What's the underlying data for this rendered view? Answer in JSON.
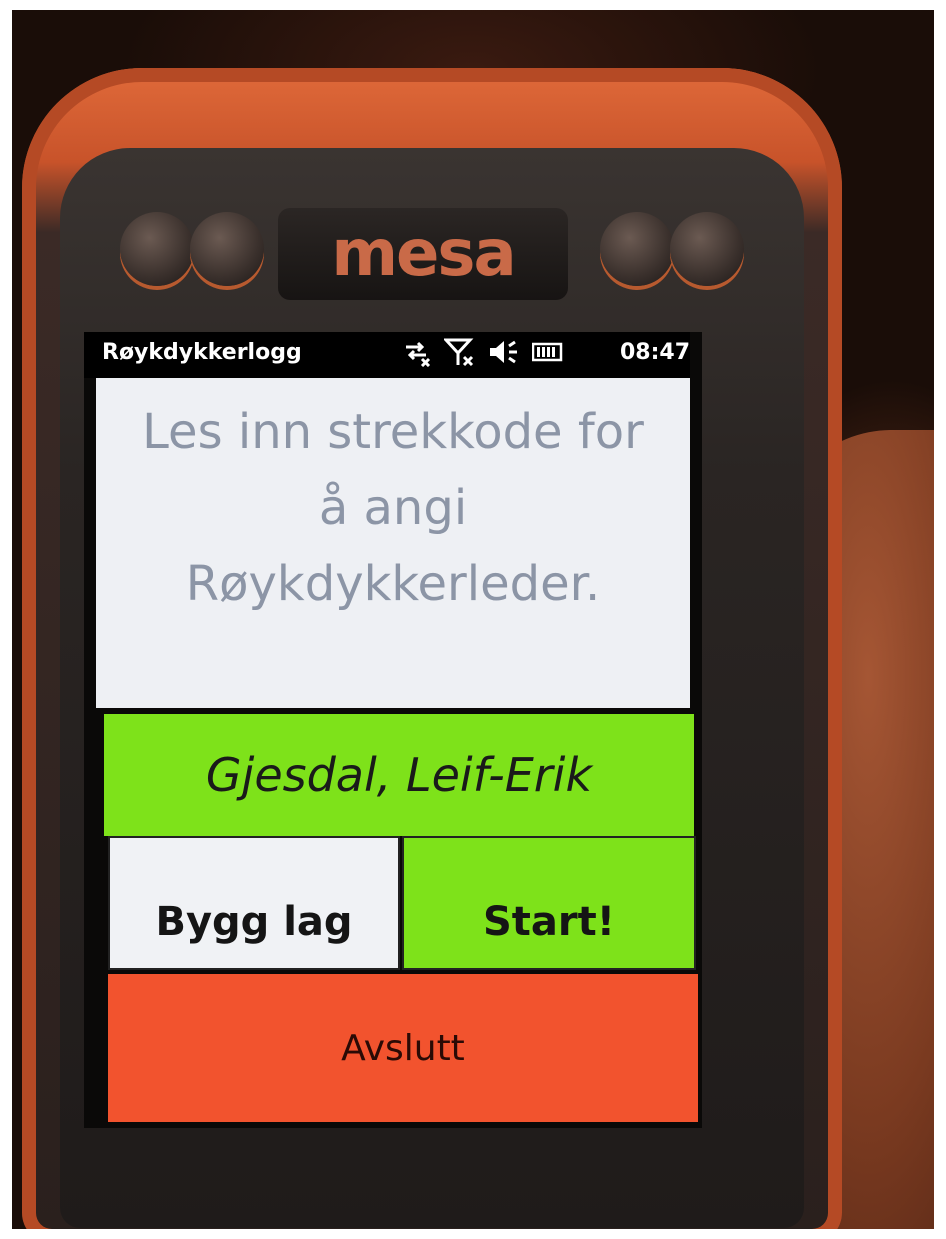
{
  "device": {
    "brand": "mesa"
  },
  "statusbar": {
    "app_title": "Røykdykkerlogg",
    "time": "08:47",
    "icons": [
      "data-off-icon",
      "signal-off-icon",
      "speaker-icon",
      "battery-icon"
    ]
  },
  "content": {
    "prompt": "Les inn strekkode for\nå angi\nRøykdykkerleder."
  },
  "leader": {
    "name": "Gjesdal, Leif-Erik"
  },
  "buttons": {
    "bygg": "Bygg lag",
    "start": "Start!",
    "quit": "Avslutt"
  },
  "colors": {
    "accent_green": "#7ee21a",
    "quit_red": "#f2532e",
    "prompt_text": "#8c95a6"
  }
}
